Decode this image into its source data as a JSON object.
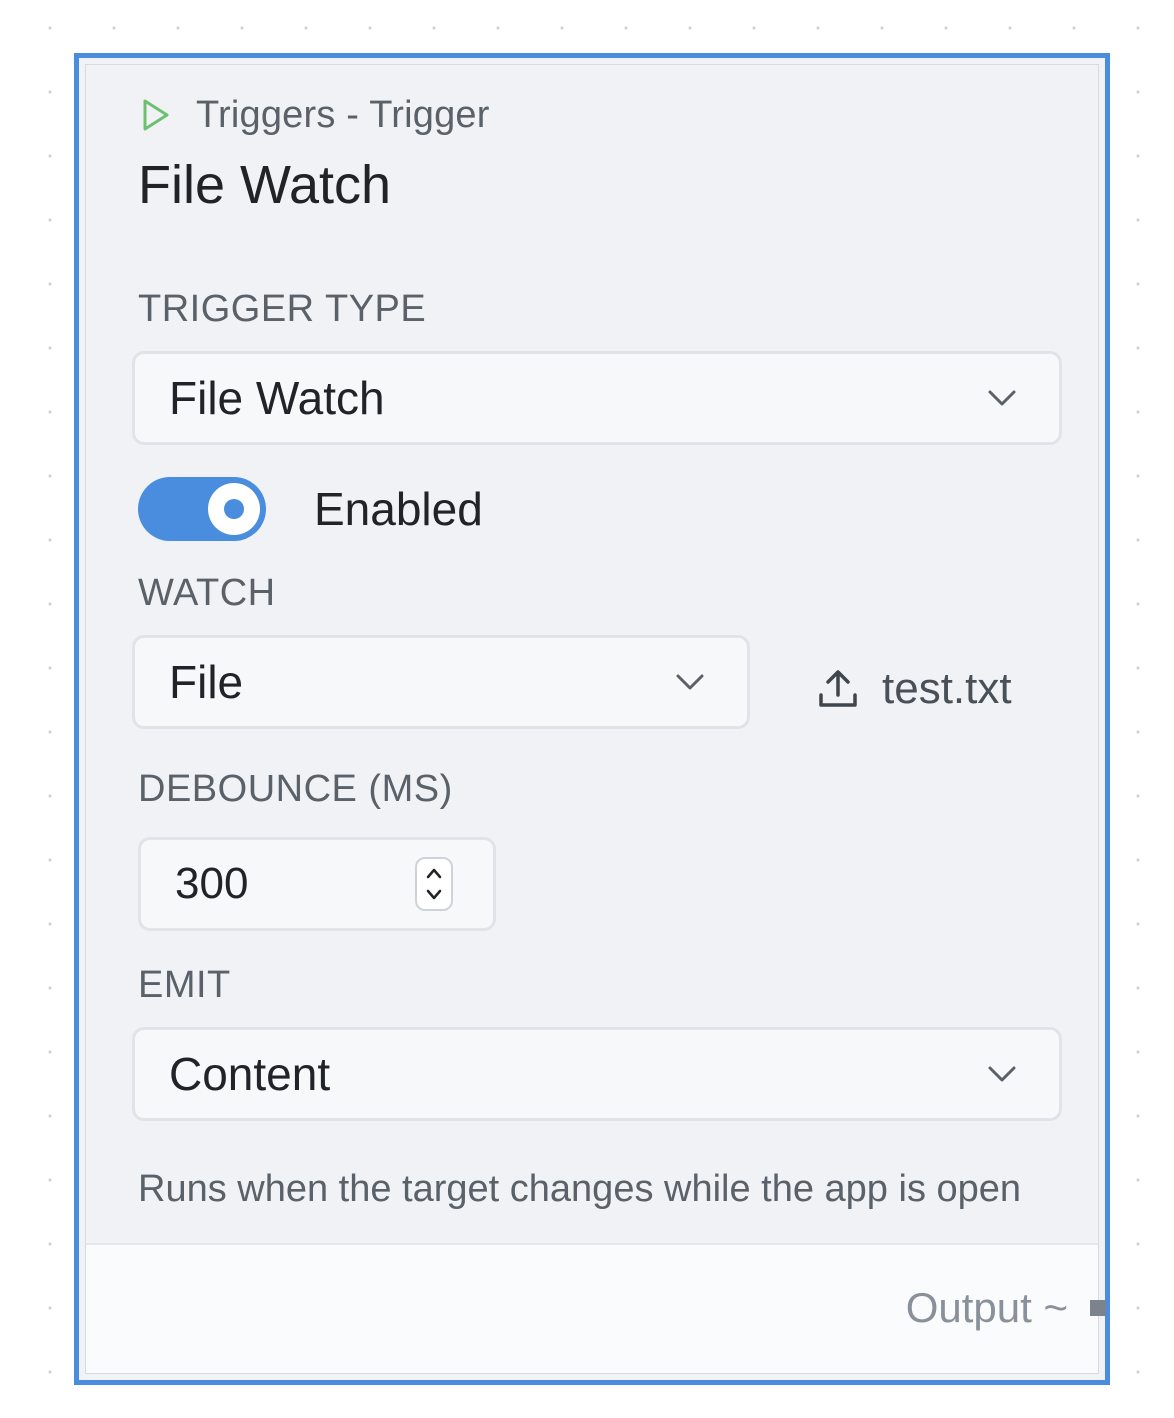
{
  "node": {
    "category": "Triggers - Trigger",
    "title": "File Watch",
    "trigger_type": {
      "label": "TRIGGER TYPE",
      "value": "File Watch"
    },
    "enabled": {
      "label": "Enabled",
      "on": true
    },
    "watch": {
      "label": "WATCH",
      "value": "File",
      "file_name": "test.txt"
    },
    "debounce": {
      "label": "DEBOUNCE (MS)",
      "value": "300"
    },
    "emit": {
      "label": "EMIT",
      "value": "Content"
    },
    "hint": "Runs when the target changes while the app is open",
    "output": {
      "label": "Output ~"
    }
  },
  "colors": {
    "accent": "#4a8ddf",
    "play_icon": "#6cc070",
    "node_background": "#f0f2f5"
  },
  "icons": {
    "header": "play-icon",
    "select": "chevron-down-icon",
    "file": "upload-icon",
    "stepper": "spinner-icon"
  }
}
